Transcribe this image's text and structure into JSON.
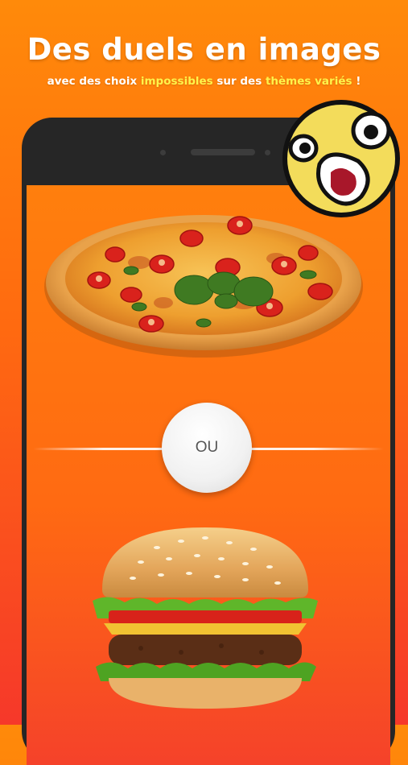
{
  "header": {
    "title": "Des duels en images",
    "subtitle_parts": [
      "avec des choix ",
      "impossibles",
      " sur des ",
      "thèmes variés",
      " !"
    ]
  },
  "duel": {
    "option_a": {
      "name": "pizza"
    },
    "separator_label": "OU",
    "option_b": {
      "name": "burger"
    }
  },
  "colors": {
    "background_top": "#ff8a0a",
    "background_bottom": "#f6382a",
    "highlight": "#fff34a",
    "phone_frame": "#262626"
  },
  "icons": [
    "surprised-emoji-icon"
  ]
}
